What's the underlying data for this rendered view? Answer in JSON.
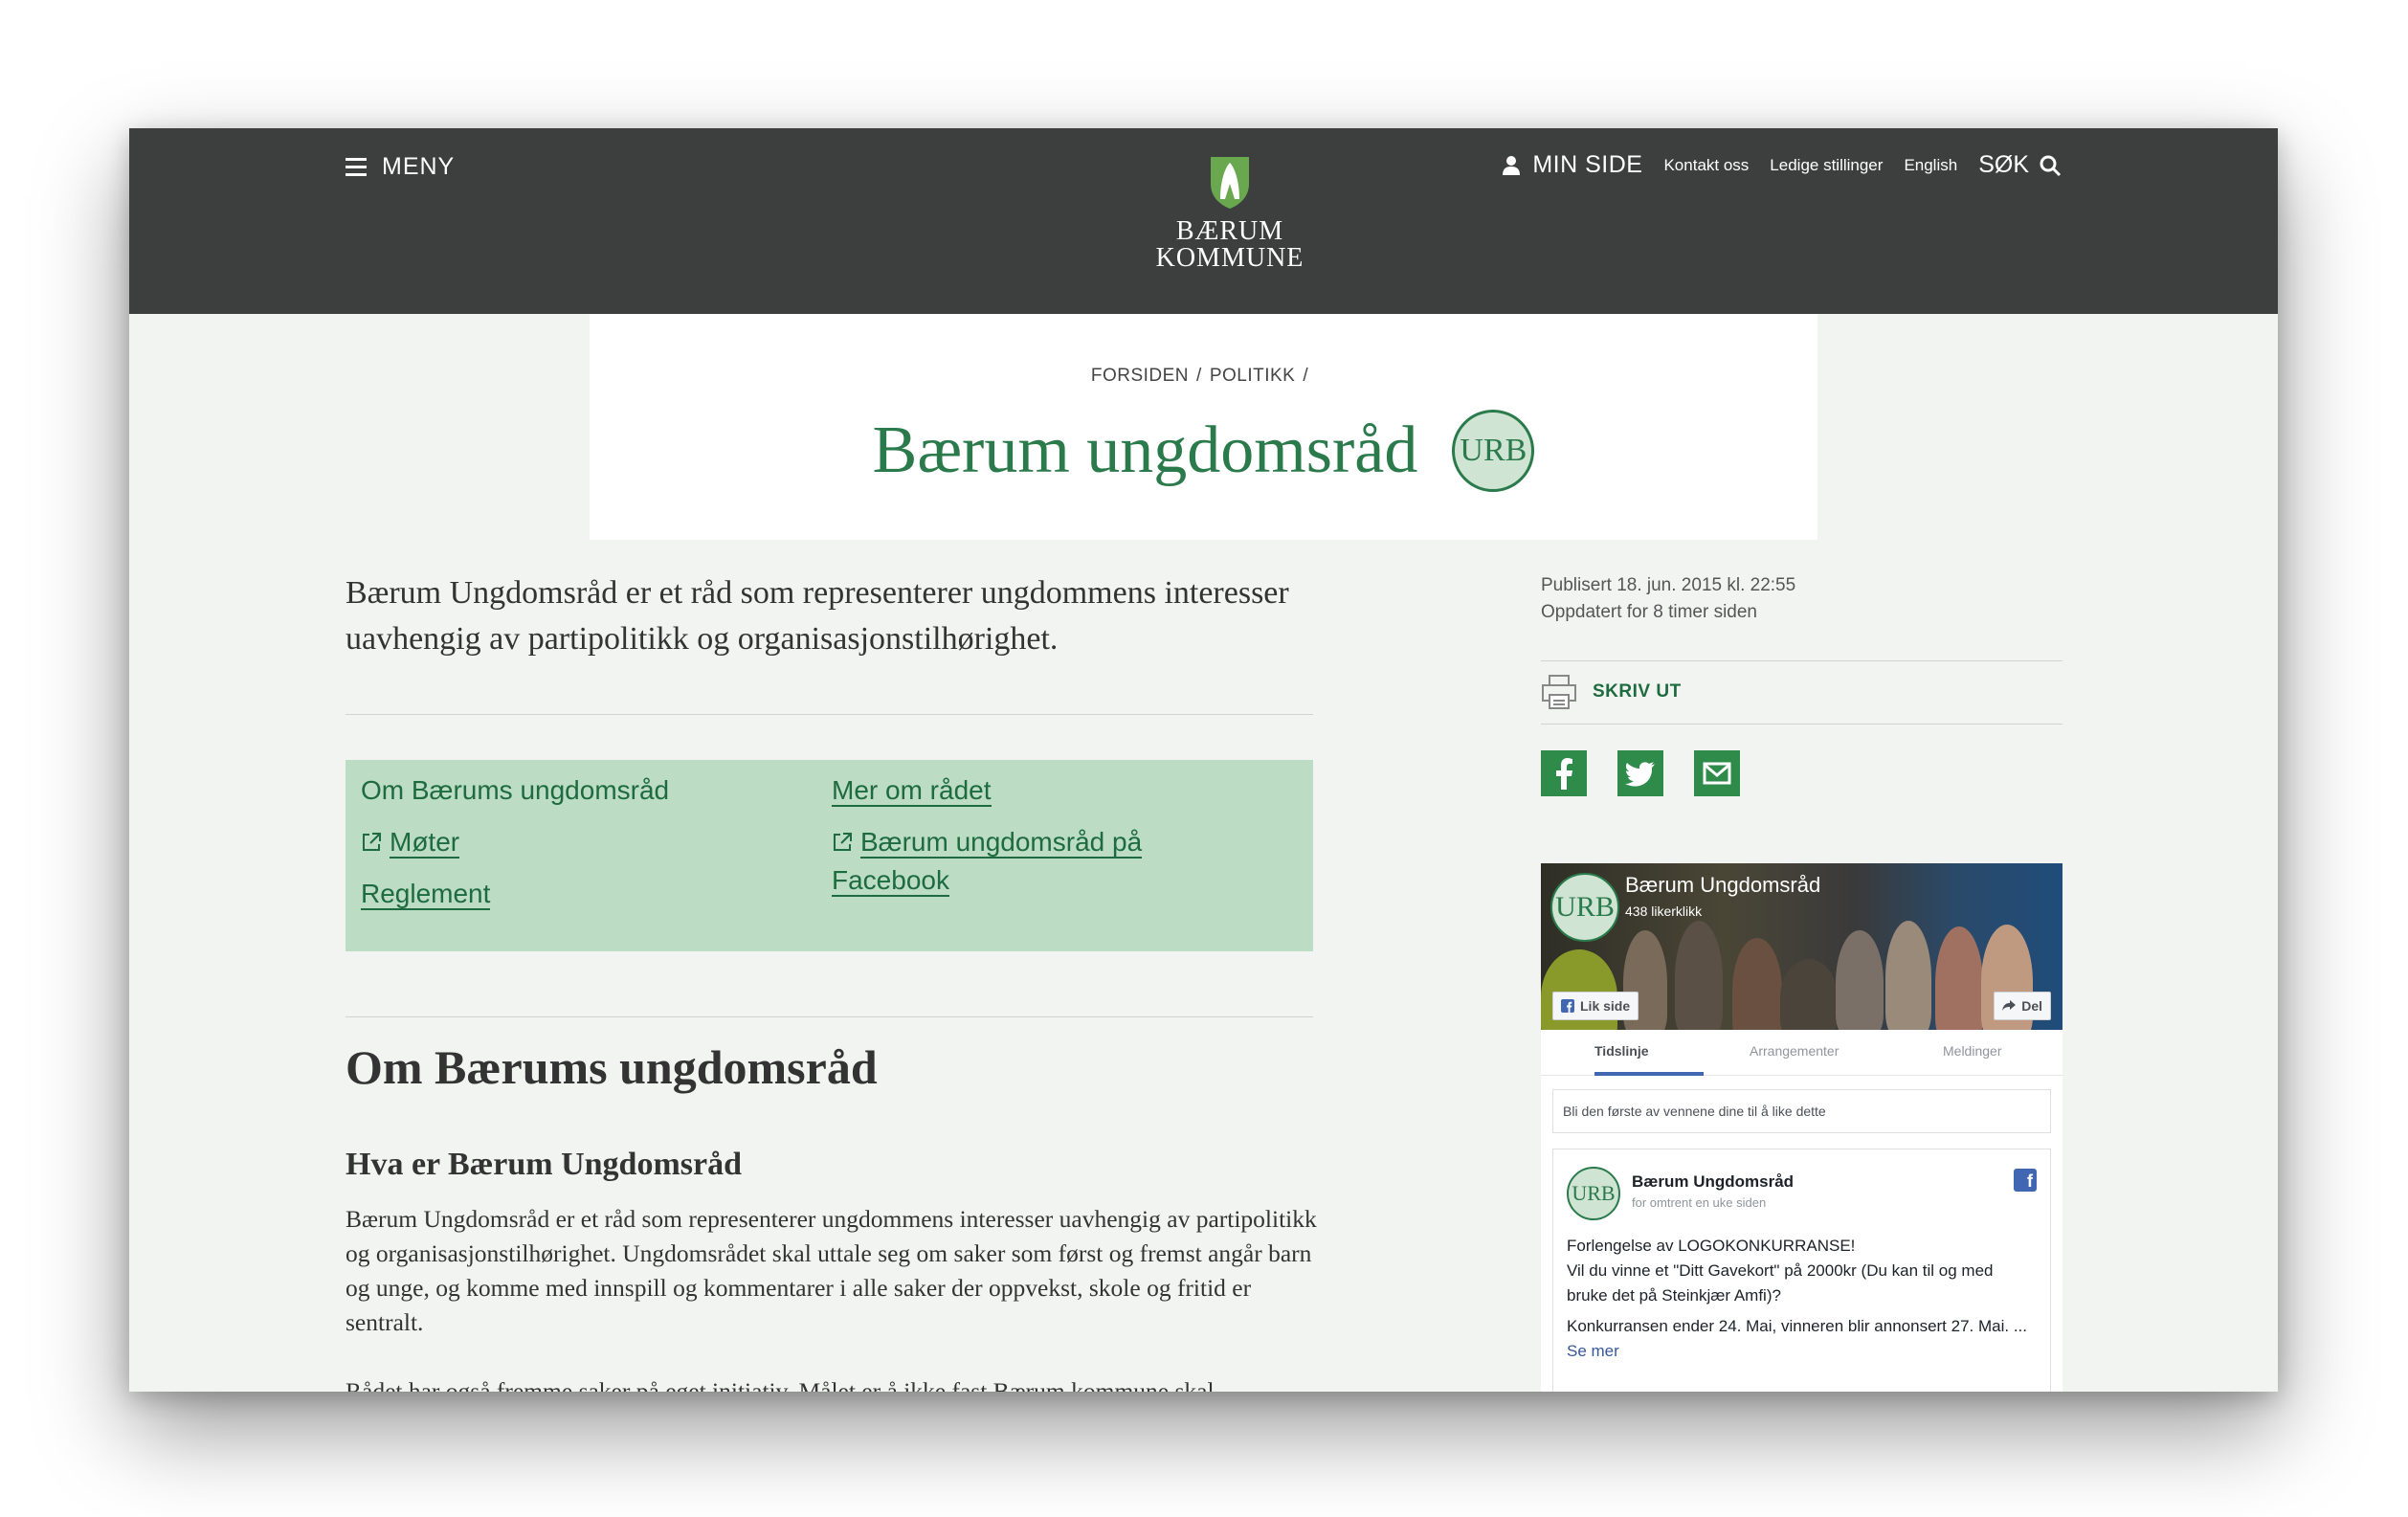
{
  "header": {
    "menu_label": "MENY",
    "logo_line1": "BÆRUM",
    "logo_line2": "KOMMUNE",
    "min_side": "MIN SIDE",
    "kontakt": "Kontakt oss",
    "stillinger": "Ledige stillinger",
    "english": "English",
    "sok": "SØK"
  },
  "breadcrumb": [
    "FORSIDEN",
    "POLITIKK"
  ],
  "breadcrumb_sep": "/",
  "title": "Bærum ungdomsråd",
  "badge_text": "URB",
  "intro": "Bærum Ungdomsråd er et råd som representerer ungdommens interesser uavhengig av partipolitikk og organisasjonstilhørighet.",
  "links": {
    "om": "Om Bærums ungdomsråd",
    "moter": "Møter",
    "reglement": "Reglement",
    "mer": "Mer om rådet",
    "facebook_line1": "Bærum ungdomsråd på",
    "facebook_line2": "Facebook"
  },
  "section_heading": "Om Bærums ungdomsråd",
  "sub_heading": "Hva er Bærum Ungdomsråd",
  "body_text": "Bærum Ungdomsråd er et råd som representerer ungdommens interesser uavhengig av partipolitikk og organisasjonstilhørighet. Ungdomsrådet skal uttale seg om saker som først og fremst angår barn og unge, og komme med innspill og kommentarer i alle saker der oppvekst, skole og fritid er sentralt.",
  "body_text_cut": "Rådet har også fremme saker på eget initiativ. Målet er å ikke fast Bærum kommune skal",
  "meta": {
    "published": "Publisert 18. jun. 2015 kl. 22:55",
    "updated": "Oppdatert for 8 timer siden"
  },
  "print_label": "SKRIV UT",
  "share_icons": [
    "facebook-icon",
    "twitter-icon",
    "email-icon"
  ],
  "facebook_widget": {
    "page_name": "Bærum Ungdomsråd",
    "likes": "438 likerklikk",
    "like_button": "Lik side",
    "share_button": "Del",
    "tabs": [
      "Tidslinje",
      "Arrangementer",
      "Meldinger"
    ],
    "active_tab": "Tidslinje",
    "first_friends": "Bli den første av vennene dine til å like dette",
    "post_author": "Bærum Ungdomsråd",
    "post_time": "for omtrent en uke siden",
    "post_line1": "Forlengelse av LOGOKONKURRANSE!",
    "post_line2": "Vil du vinne et \"Ditt Gavekort\" på 2000kr (Du kan til og med bruke det på Steinkjær Amfi)?",
    "post_line3": "Konkurransen ender 24. Mai, vinneren blir annonsert 27. Mai. ...",
    "see_more": "Se mer"
  },
  "colors": {
    "header_bg": "#3d3f3f",
    "brand_green": "#2b7a4b",
    "link_box": "#bcdcc4",
    "page_bg": "#f2f4f2",
    "fb_blue": "#4267b2"
  }
}
